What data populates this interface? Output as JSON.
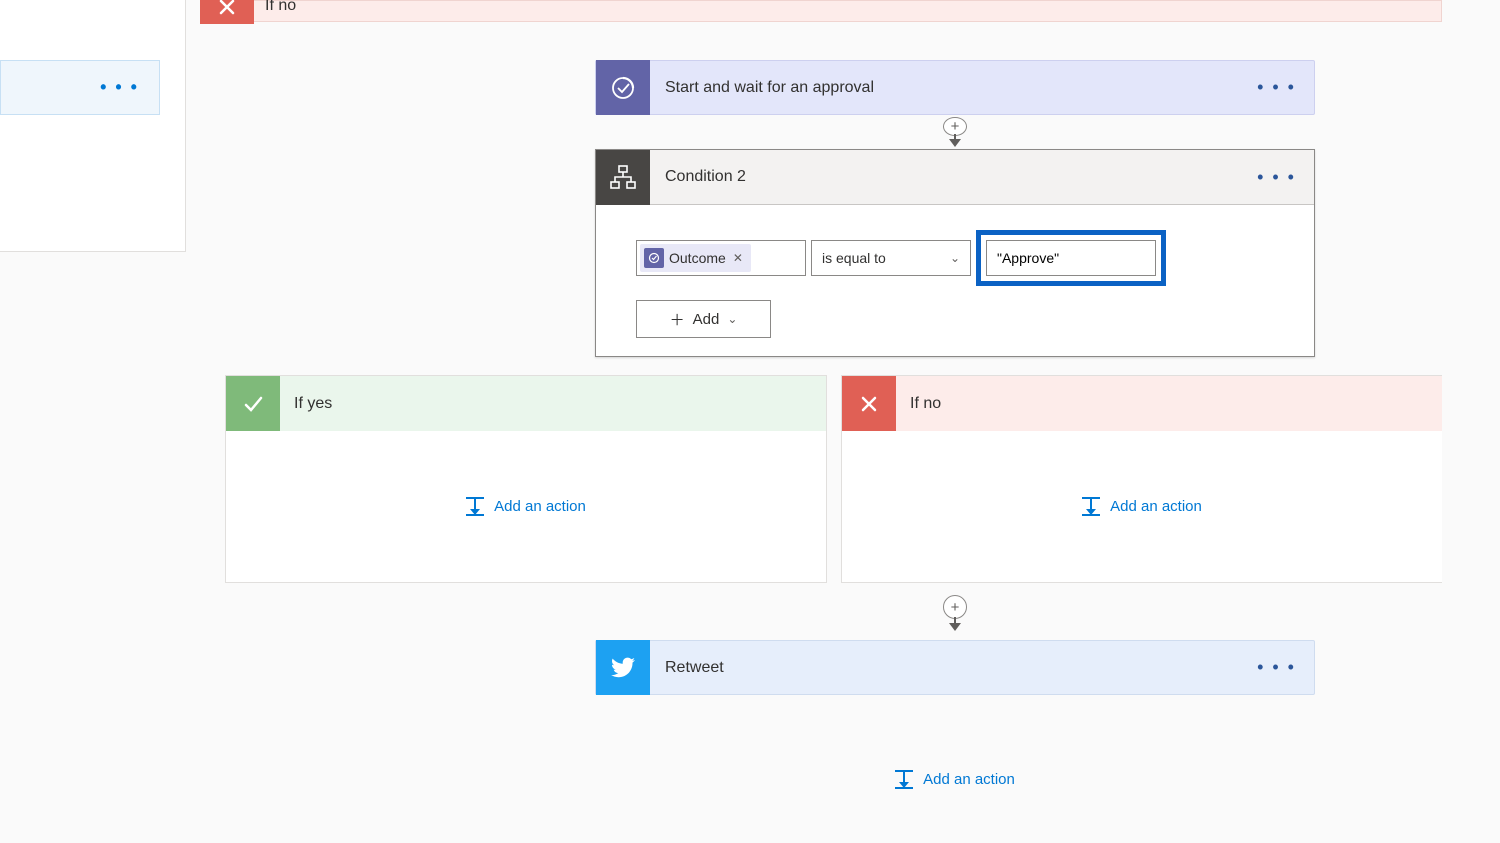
{
  "top_fragment": {
    "ifno_label": "If no",
    "sub_dots": "• • •"
  },
  "approval": {
    "title": "Start and wait for an approval",
    "menu": "• • •"
  },
  "condition": {
    "title": "Condition 2",
    "menu": "• • •",
    "token_label": "Outcome",
    "operator": "is equal to",
    "value": "\"Approve\"",
    "add_label": "Add"
  },
  "branches": {
    "yes_label": "If yes",
    "no_label": "If no",
    "add_action_label": "Add an action"
  },
  "retweet": {
    "title": "Retweet",
    "menu": "• • •"
  },
  "bottom": {
    "add_action_label": "Add an action"
  }
}
